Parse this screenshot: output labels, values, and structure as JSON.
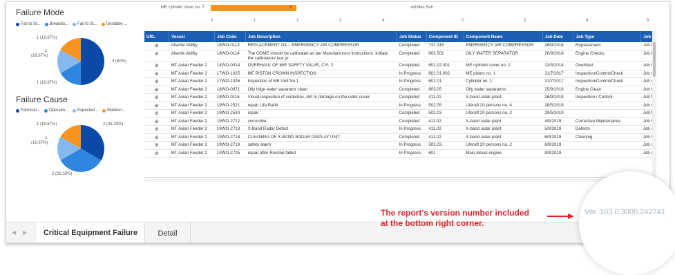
{
  "top_chart_left": {
    "label": "ME cylinder cover no. 7",
    "bar_value": "2",
    "ticks": [
      "0",
      "1",
      "2",
      "3",
      "4"
    ]
  },
  "top_chart_right": {
    "label": "Achilles Sun",
    "ticks": [
      "0",
      "2",
      "4",
      "6"
    ]
  },
  "failure_mode": {
    "title": "Failure Mode",
    "legend": [
      {
        "label": "Fail to St...",
        "color": "#0a4aa6"
      },
      {
        "label": "Breakdo...",
        "color": "#2e86de"
      },
      {
        "label": "Fail to St...",
        "color": "#85b8ef"
      },
      {
        "label": "Unstable ...",
        "color": "#f7931e"
      }
    ],
    "slice_labels": [
      "1 (16.67%)",
      "1",
      "(16.67%)",
      "1 (16.67%)",
      "3 (50%)"
    ]
  },
  "failure_cause": {
    "title": "Failure Cause",
    "legend": [
      {
        "label": "Fabricati...",
        "color": "#0a4aa6"
      },
      {
        "label": "Operatin...",
        "color": "#2e86de"
      },
      {
        "label": "Expected...",
        "color": "#85b8ef"
      },
      {
        "label": "Mainten...",
        "color": "#f7931e"
      }
    ],
    "slice_labels": [
      "1 (16.67%)",
      "1",
      "(16.67%)",
      "2 (33.33%)",
      "2 (33.33%)"
    ]
  },
  "table": {
    "columns": [
      "URL",
      "Vessel",
      "Job Code",
      "Job Description",
      "Job Status",
      "Component ID",
      "Component Name",
      "Job Date",
      "Job Type",
      "Job Ca"
    ],
    "rows": [
      [
        "Atlantic Ability",
        "18WO-0113",
        "REPLACEMENT OIL:- EMERGENCY AIR COMPRESSOR",
        "Completed",
        "731.315",
        "EMERGENCY AIR COMPRESSOR",
        "26/9/2018",
        "Replacement",
        "Job his"
      ],
      [
        "Atlantic Ability",
        "18WO-0114",
        "The ODME should be calibrated as per Manufacturers instructions. Initiate the calibration/ test pr",
        "Completed",
        "803.501",
        "OILY WATER SEPARATOR",
        "26/9/2018",
        "Engine Checks",
        "Job his"
      ],
      [
        "MT Asian Feeder 2",
        "14WO-0014",
        "OVERHAUL OF M/E SAFETY VALVE, CYL 2",
        "Completed",
        "601.02.001",
        "ME cylinder cover no. 2",
        "13/3/2014",
        "Overhaul",
        "Job his"
      ],
      [
        "MT Asian Feeder 2",
        "17WO-1025",
        "ME PISTON CROWN INSPECTION",
        "In Progress",
        "601.01.002",
        "ME piston no. 1",
        "31/7/2017",
        "Inspection/Control/Check",
        "Job on"
      ],
      [
        "MT Asian Feeder 2",
        "17WO-1026",
        "Inspection of ME Unit No.1",
        "In Progress",
        "601.01",
        "Cylinder no. 1",
        "31/7/2017",
        "Inspection/Control/Check",
        "Job on"
      ],
      [
        "MT Asian Feeder 2",
        "18WO-0071",
        "Oily bilge water separator clean",
        "Completed",
        "803.05",
        "Oily water separators",
        "25/9/2018",
        "Engine Clean",
        "Job his"
      ],
      [
        "MT Asian Feeder 2",
        "18WO-0116",
        "Visual inspection of scratches, dirt or damage on the outer cover.",
        "Completed",
        "411.01",
        "S-band radar plant",
        "26/9/2018",
        "Inspection / Control",
        "Job his"
      ],
      [
        "MT Asian Feeder 2",
        "19WO-2521",
        "repair Life Raft#",
        "In Progress",
        "502.05",
        "Liferaft 20 persons no. 4",
        "28/5/2019",
        "",
        "Job on"
      ],
      [
        "MT Asian Feeder 2",
        "19WO-2533",
        "repair",
        "Completed",
        "502.03",
        "Liferaft 20 persons no. 2",
        "29/5/2019",
        "",
        "Job his"
      ],
      [
        "MT Asian Feeder 2",
        "19WO-2712",
        "corrective",
        "Completed",
        "411.02",
        "X-band radar plant",
        "4/9/2019",
        "Corrective Maintenance",
        "Job his"
      ],
      [
        "MT Asian Feeder 2",
        "19WO-2713",
        "X-Band Radar Defect",
        "In Progress",
        "411.02",
        "X-band radar plant",
        "5/9/2019",
        "Defects",
        "Job on"
      ],
      [
        "MT Asian Feeder 2",
        "19WO-2718",
        "CLEANING OF X-BAND RADAR DISPLAY UNIT",
        "Completed",
        "411.02",
        "X-band radar plant",
        "6/9/2019",
        "Cleaning",
        "Job his"
      ],
      [
        "MT Asian Feeder 2",
        "19WO-2719",
        "safety alarm",
        "In Progress",
        "502.03",
        "Liferaft 20 persons no. 2",
        "6/9/2019",
        "",
        "Job on"
      ],
      [
        "MT Asian Feeder 2",
        "19WO-2725",
        "repair after Routine failed",
        "In Progress",
        "601",
        "Main diesel engine",
        "9/9/2019",
        "",
        "Job on"
      ]
    ]
  },
  "tabs": [
    "Critical Equipment Failure",
    "Detail"
  ],
  "annotation": {
    "line1": "The report's version number included",
    "line2": "at the bottom right corner.",
    "version": "Ver. 103.0.3000.242741",
    "color": "#e0242b"
  }
}
